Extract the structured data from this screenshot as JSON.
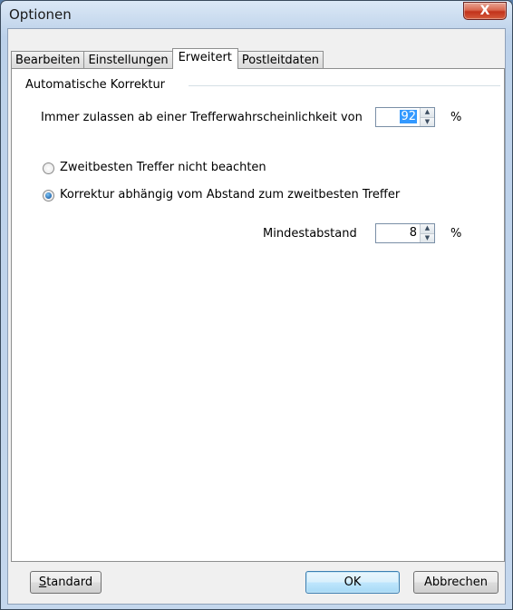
{
  "window": {
    "title": "Optionen",
    "close_glyph": "X"
  },
  "tabs": [
    {
      "label": "Bearbeiten",
      "active": false
    },
    {
      "label": "Einstellungen",
      "active": false
    },
    {
      "label": "Erweitert",
      "active": true
    },
    {
      "label": "Postleitdaten",
      "active": false
    }
  ],
  "group": {
    "title": "Automatische Korrektur"
  },
  "threshold": {
    "label": "Immer zulassen ab einer Trefferwahrscheinlichkeit von",
    "value": "92",
    "unit": "%"
  },
  "options": {
    "ignore_second": {
      "label": "Zweitbesten Treffer nicht beachten",
      "checked": false
    },
    "distance_based": {
      "label": "Korrektur abhängig vom Abstand zum zweitbesten Treffer",
      "checked": true
    }
  },
  "min_distance": {
    "label": "Mindestabstand",
    "value": "8",
    "unit": "%"
  },
  "buttons": {
    "standard_first": "S",
    "standard_rest": "tandard",
    "ok": "OK",
    "cancel": "Abbrechen"
  },
  "icons": {
    "close": "close-icon",
    "spin_up": "up-arrow-icon",
    "spin_down": "down-arrow-icon"
  }
}
